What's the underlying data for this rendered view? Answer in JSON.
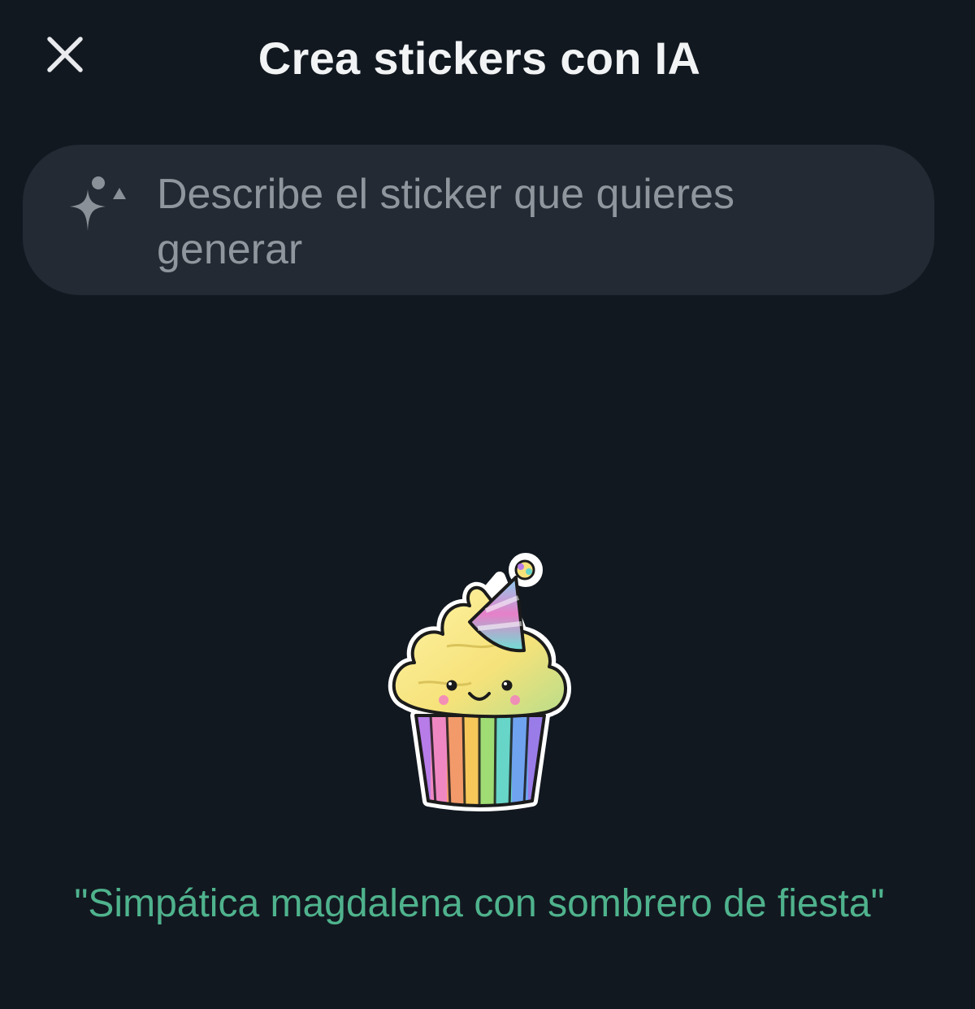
{
  "header": {
    "title": "Crea stickers con IA",
    "close_icon": "close-icon"
  },
  "prompt": {
    "placeholder": "Describe el sticker que quieres generar",
    "icon": "sparkle-icon"
  },
  "sticker": {
    "subject": "cupcake-party-hat-sticker",
    "caption": "\"Simpática magdalena con sombrero de fiesta\""
  },
  "colors": {
    "background": "#121820",
    "input_background": "#232a33",
    "title": "#f1f3f4",
    "placeholder": "#8f969d",
    "caption": "#4fb38d"
  }
}
